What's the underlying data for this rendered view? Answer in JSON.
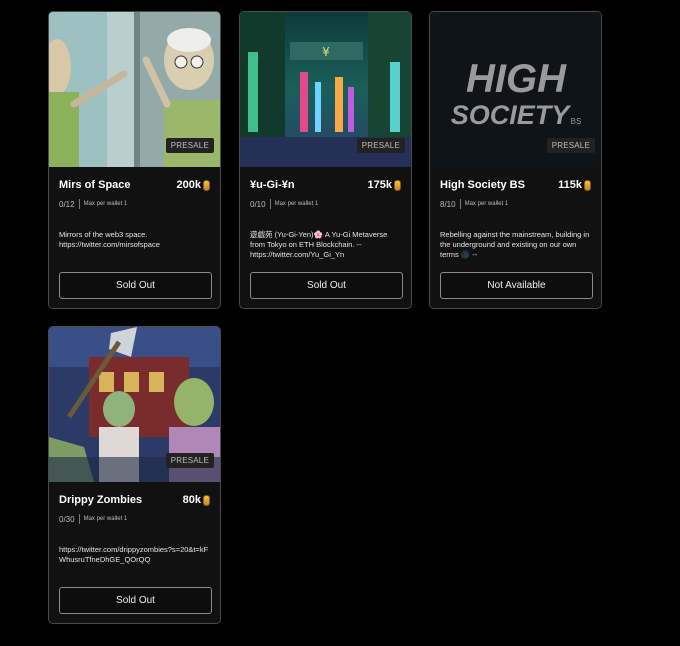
{
  "cards": [
    {
      "name": "Mirs of Space",
      "price": "200k",
      "badge": "PRESALE",
      "count": "0/12",
      "per_wallet": "Max per wallet 1",
      "description": "Mirrors of the web3 space. https://twitter.com/mirsofspace",
      "button": "Sold Out"
    },
    {
      "name": "¥u-Gi-¥n",
      "price": "175k",
      "badge": "PRESALE",
      "count": "0/10",
      "per_wallet": "Max per wallet 1",
      "description": "遊戯苑 (Yu-Gi-Yen)🌸 A Yu-Gi Metaverse from Tokyo on ETH Blockchain. -- https://twitter.com/Yu_Gi_Yn",
      "button": "Sold Out"
    },
    {
      "name": "High Society BS",
      "price": "115k",
      "badge": "PRESALE",
      "count": "8/10",
      "per_wallet": "Max per wallet 1",
      "description": "Rebelling against the mainstream, building in the underground and existing on our own terms 🌑 --",
      "button": "Not Available",
      "logo_line1": "HIGH",
      "logo_line2": "SOCIETY",
      "logo_bs": "BS"
    },
    {
      "name": "Drippy Zombies",
      "price": "80k",
      "badge": "PRESALE",
      "count": "0/30",
      "per_wallet": "Max per wallet 1",
      "description": "https://twitter.com/drippyzombies?s=20&t=kFWhusruTfneDhGE_QOrQQ",
      "button": "Sold Out"
    }
  ],
  "coin_icon": "coin-icon",
  "colors": {
    "background": "#000000",
    "card": "#111111",
    "border": "#4a4a4a"
  }
}
